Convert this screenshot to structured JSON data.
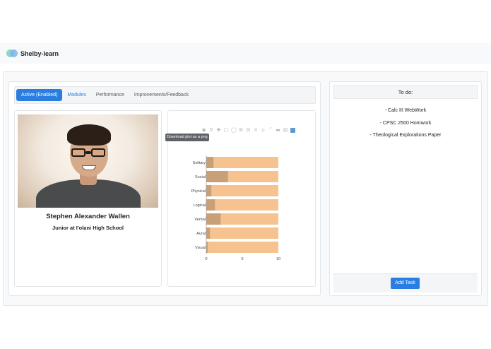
{
  "brand": {
    "name": "Shelby-learn"
  },
  "tabs": [
    {
      "label": "Active (Enabled)",
      "active": true
    },
    {
      "label": "Modules"
    },
    {
      "label": "Performance"
    },
    {
      "label": "Improvements/Feedback"
    }
  ],
  "profile": {
    "name": "Stephen Alexander Wallen",
    "school": "Junior at I'olani High School"
  },
  "plot_toolbar": {
    "icons": [
      "camera-icon",
      "zoom-icon",
      "pan-icon",
      "box-select-icon",
      "lasso-select-icon",
      "zoom-in-icon",
      "zoom-out-icon",
      "autoscale-icon",
      "reset-axes-icon",
      "spike-lines-icon",
      "hover-closest-icon",
      "hover-compare-icon",
      "plotly-logo-icon"
    ],
    "tooltip": "Download plot as a png"
  },
  "chart_data": {
    "type": "bar",
    "orientation": "horizontal",
    "categories": [
      "Solitary",
      "Social",
      "Physical",
      "Logical",
      "Verbal",
      "Aural",
      "Visual"
    ],
    "series": [
      {
        "values": [
          10,
          10,
          10,
          10,
          10,
          10,
          10
        ],
        "color": "#f6c28f"
      },
      {
        "values": [
          1.0,
          3.0,
          0.7,
          1.2,
          2.0,
          0.5,
          0.2
        ],
        "color": "#c8a078"
      }
    ],
    "xlim": [
      0,
      10
    ],
    "xticks": [
      0,
      5,
      10
    ]
  },
  "todo": {
    "header": "To do:",
    "items": [
      "- Calc III WebWork",
      "- CPSC 2500 Homwork",
      "- Theological Explorations Paper"
    ],
    "add_button": "Add Task"
  }
}
